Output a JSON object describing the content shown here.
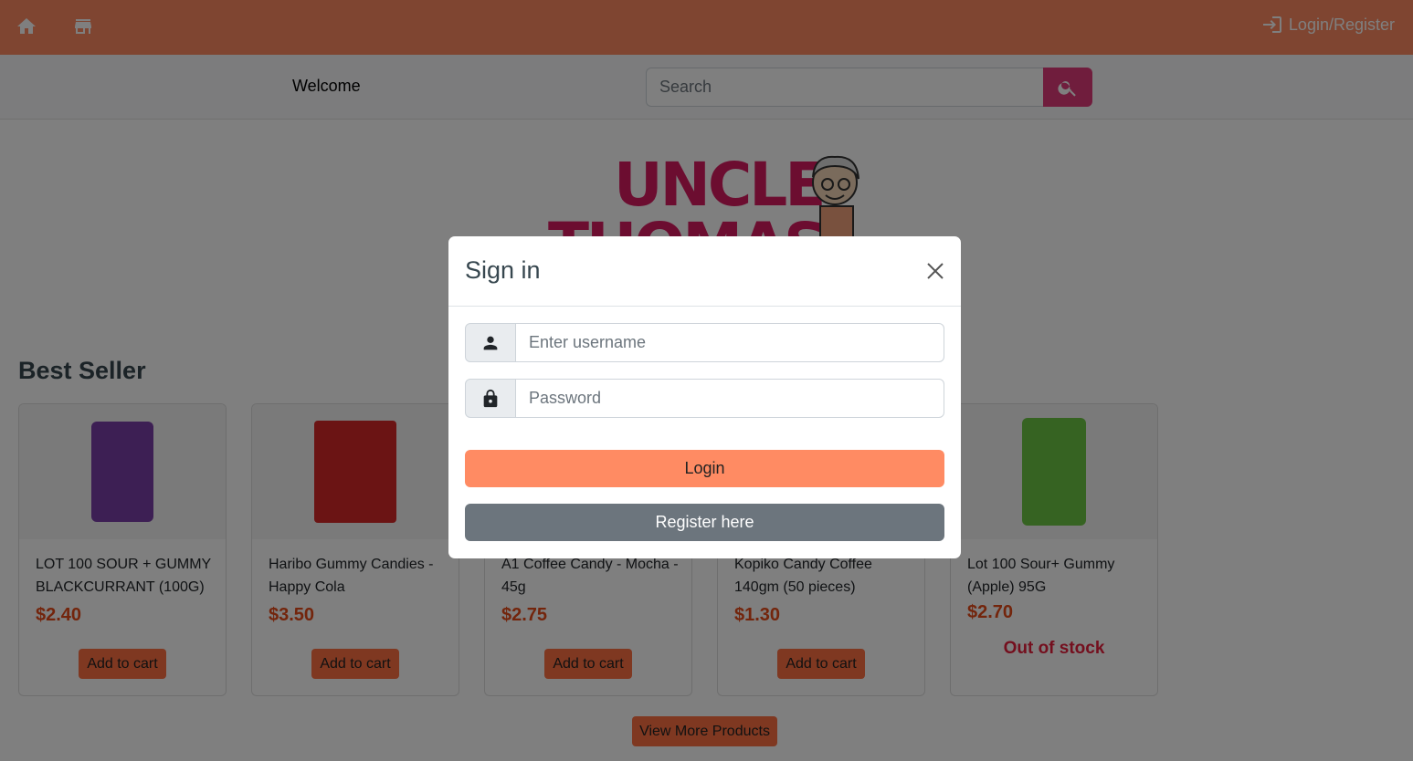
{
  "nav": {
    "home_icon": "home-icon",
    "store_icon": "store-icon",
    "login_label": "Login/Register"
  },
  "subheader": {
    "welcome": "Welcome",
    "search_placeholder": "Search"
  },
  "logo": {
    "line1": "UNCLE",
    "line2": "THOMAS"
  },
  "section": {
    "title": "Best Seller"
  },
  "products": [
    {
      "name": "LOT 100 SOUR + GUMMY BLACKCURRANT (100G)",
      "price": "$2.40",
      "action": "Add to cart",
      "color": "#7b3fa8"
    },
    {
      "name": "Haribo Gummy Candies - Happy Cola",
      "price": "$3.50",
      "action": "Add to cart",
      "color": "#d62828"
    },
    {
      "name": "A1 Coffee Candy - Mocha - 45g",
      "price": "$2.75",
      "action": "Add to cart",
      "color": "#6b4226"
    },
    {
      "name": "Kopiko Candy Coffee 140gm (50 pieces)",
      "price": "$1.30",
      "action": "Add to cart",
      "color": "#8b1a1a"
    },
    {
      "name": "Lot 100 Sour+ Gummy (Apple) 95G",
      "price": "$2.70",
      "status": "Out of stock",
      "color": "#6cc644"
    }
  ],
  "more_button": "View More Products",
  "modal": {
    "title": "Sign in",
    "username_placeholder": "Enter username",
    "password_placeholder": "Password",
    "login_label": "Login",
    "register_label": "Register here"
  },
  "colors": {
    "navbar": "#ff8b63",
    "accent": "#e03a7a",
    "price": "#e64a19",
    "out_of_stock": "#e91e3c",
    "register": "#6c757d"
  }
}
